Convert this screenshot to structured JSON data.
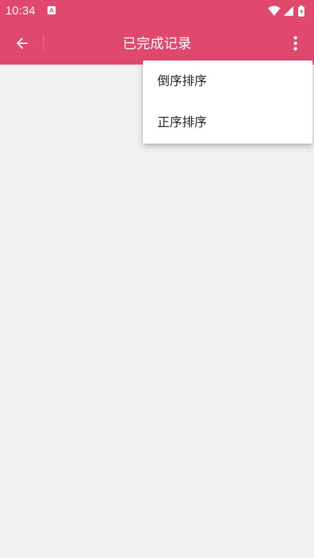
{
  "status_bar": {
    "time": "10:34",
    "notification_icon": "a-box-icon",
    "icons": [
      "wifi-icon",
      "cellular-signal-icon",
      "battery-charging-icon"
    ]
  },
  "app_bar": {
    "title": "已完成记录",
    "back_icon": "arrow-left-icon",
    "more_icon": "more-vertical-icon",
    "color": "#e0496d"
  },
  "sort_menu": {
    "items": [
      {
        "label": "倒序排序"
      },
      {
        "label": "正序排序"
      }
    ]
  },
  "colors": {
    "accent": "#e0496d",
    "background": "#f1f1f3",
    "menu_background": "#ffffff"
  }
}
